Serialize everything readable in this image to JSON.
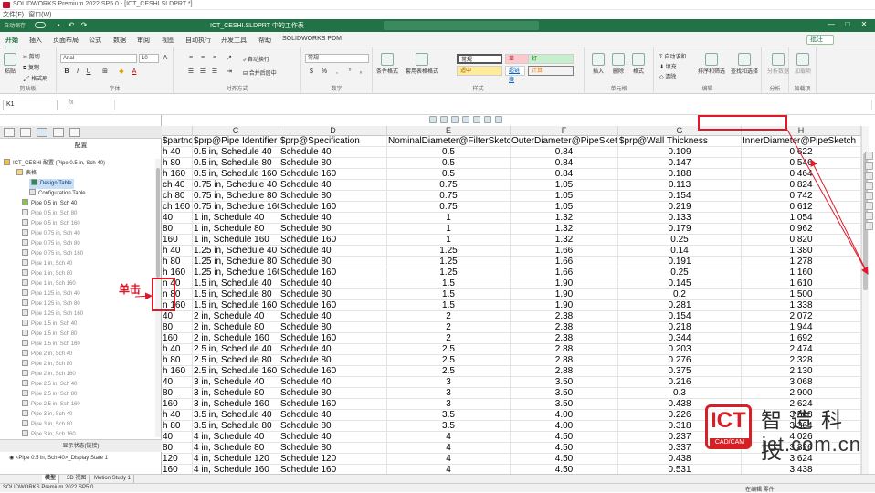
{
  "window": {
    "title": "SOLIDWORKS Premium 2022 SP5.0 - [ICT_CESHI.SLDPRT *]"
  },
  "menubar": {
    "items": [
      "文件(F)",
      "窗口(W)"
    ]
  },
  "qat": {
    "autosave": "自动保存",
    "filename": "ICT_CESHI.SLDPRT 中的工作表",
    "user": "",
    "min": "—",
    "max": "□",
    "close": "✕"
  },
  "tabs": {
    "items": [
      "开始",
      "插入",
      "页面布局",
      "公式",
      "数据",
      "审阅",
      "视图",
      "自动执行",
      "开发工具",
      "帮助",
      "SOLIDWORKS PDM"
    ],
    "active": 0,
    "comment": "批注"
  },
  "ribbon": {
    "clipboard": {
      "label": "剪贴板",
      "paste": "粘贴",
      "cut": "剪切",
      "copy": "复制",
      "format_painter": "格式刷"
    },
    "font": {
      "label": "字体",
      "name": "Arial",
      "size": "10"
    },
    "align": {
      "label": "对齐方式",
      "wrap": "自动换行",
      "merge": "合并后居中"
    },
    "number": {
      "label": "数字",
      "format": "常规"
    },
    "styles": {
      "label": "样式",
      "cond": "条件格式",
      "table": "套用表格格式",
      "normal": "常规",
      "bad": "差",
      "good": "好",
      "neutral": "适中",
      "hyperlink": "超链接",
      "calc": "计算"
    },
    "cells": {
      "label": "单元格",
      "insert": "插入",
      "delete": "删除",
      "format": "格式"
    },
    "editing": {
      "label": "编辑",
      "autosum": "自动求和",
      "fill": "填充",
      "clear": "清除",
      "sort": "排序和筛选",
      "find": "查找和选择"
    },
    "analysis": {
      "label": "分析",
      "analyze": "分析数据"
    },
    "addins": {
      "label": "加载项",
      "addins": "加载项"
    }
  },
  "formula_bar": {
    "name_box": "K1",
    "fx": "fx",
    "value": ""
  },
  "columns": [
    {
      "letter": "",
      "header": "$partno"
    },
    {
      "letter": "C",
      "header": "$prp@Pipe Identifier"
    },
    {
      "letter": "D",
      "header": "$prp@Specification"
    },
    {
      "letter": "E",
      "header": "NominalDiameter@FilterSketch"
    },
    {
      "letter": "F",
      "header": "OuterDiameter@PipeSketch"
    },
    {
      "letter": "G",
      "header": "$prp@Wall Thickness"
    },
    {
      "letter": "H",
      "header": "InnerDiameter@PipeSketch"
    }
  ],
  "rows": [
    [
      "h 40",
      "0.5 in, Schedule 40",
      "Schedule 40",
      "0.5",
      "0.84",
      "0.109",
      "0.622"
    ],
    [
      "h 80",
      "0.5 in, Schedule 80",
      "Schedule 80",
      "0.5",
      "0.84",
      "0.147",
      "0.546"
    ],
    [
      "h 160",
      "0.5 in, Schedule 160",
      "Schedule 160",
      "0.5",
      "0.84",
      "0.188",
      "0.464"
    ],
    [
      "ch 40",
      "0.75 in, Schedule 40",
      "Schedule 40",
      "0.75",
      "1.05",
      "0.113",
      "0.824"
    ],
    [
      "ch 80",
      "0.75 in, Schedule 80",
      "Schedule 80",
      "0.75",
      "1.05",
      "0.154",
      "0.742"
    ],
    [
      "ch 160",
      "0.75 in, Schedule 160",
      "Schedule 160",
      "0.75",
      "1.05",
      "0.219",
      "0.612"
    ],
    [
      "40",
      "1 in, Schedule 40",
      "Schedule 40",
      "1",
      "1.32",
      "0.133",
      "1.054"
    ],
    [
      "80",
      "1 in, Schedule 80",
      "Schedule 80",
      "1",
      "1.32",
      "0.179",
      "0.962"
    ],
    [
      "160",
      "1 in, Schedule 160",
      "Schedule 160",
      "1",
      "1.32",
      "0.25",
      "0.820"
    ],
    [
      "h 40",
      "1.25 in, Schedule 40",
      "Schedule 40",
      "1.25",
      "1.66",
      "0.14",
      "1.380"
    ],
    [
      "h 80",
      "1.25 in, Schedule 80",
      "Schedule 80",
      "1.25",
      "1.66",
      "0.191",
      "1.278"
    ],
    [
      "h 160",
      "1.25 in, Schedule 160",
      "Schedule 160",
      "1.25",
      "1.66",
      "0.25",
      "1.160"
    ],
    [
      "n 40",
      "1.5 in, Schedule 40",
      "Schedule 40",
      "1.5",
      "1.90",
      "0.145",
      "1.610"
    ],
    [
      "n 80",
      "1.5 in, Schedule 80",
      "Schedule 80",
      "1.5",
      "1.90",
      "0.2",
      "1.500"
    ],
    [
      "n 160",
      "1.5 in, Schedule 160",
      "Schedule 160",
      "1.5",
      "1.90",
      "0.281",
      "1.338"
    ],
    [
      "40",
      "2 in, Schedule 40",
      "Schedule 40",
      "2",
      "2.38",
      "0.154",
      "2.072"
    ],
    [
      "80",
      "2 in, Schedule 80",
      "Schedule 80",
      "2",
      "2.38",
      "0.218",
      "1.944"
    ],
    [
      "160",
      "2 in, Schedule 160",
      "Schedule 160",
      "2",
      "2.38",
      "0.344",
      "1.692"
    ],
    [
      "h 40",
      "2.5 in, Schedule 40",
      "Schedule 40",
      "2.5",
      "2.88",
      "0.203",
      "2.474"
    ],
    [
      "h 80",
      "2.5 in, Schedule 80",
      "Schedule 80",
      "2.5",
      "2.88",
      "0.276",
      "2.328"
    ],
    [
      "h 160",
      "2.5 in, Schedule 160",
      "Schedule 160",
      "2.5",
      "2.88",
      "0.375",
      "2.130"
    ],
    [
      "40",
      "3 in, Schedule 40",
      "Schedule 40",
      "3",
      "3.50",
      "0.216",
      "3.068"
    ],
    [
      "80",
      "3 in, Schedule 80",
      "Schedule 80",
      "3",
      "3.50",
      "0.3",
      "2.900"
    ],
    [
      "160",
      "3 in, Schedule 160",
      "Schedule 160",
      "3",
      "3.50",
      "0.438",
      "2.624"
    ],
    [
      "h 40",
      "3.5 in, Schedule 40",
      "Schedule 40",
      "3.5",
      "4.00",
      "0.226",
      "3.548"
    ],
    [
      "h 80",
      "3.5 in, Schedule 80",
      "Schedule 80",
      "3.5",
      "4.00",
      "0.318",
      "3.364"
    ],
    [
      "40",
      "4 in, Schedule 40",
      "Schedule 40",
      "4",
      "4.50",
      "0.237",
      "4.026"
    ],
    [
      "80",
      "4 in, Schedule 80",
      "Schedule 80",
      "4",
      "4.50",
      "0.337",
      "3.826"
    ],
    [
      "120",
      "4 in, Schedule 120",
      "Schedule 120",
      "4",
      "4.50",
      "0.438",
      "3.624"
    ],
    [
      "160",
      "4 in, Schedule 160",
      "Schedule 160",
      "4",
      "4.50",
      "0.531",
      "3.438"
    ]
  ],
  "panel": {
    "title": "配置",
    "root": "ICT_CESHI 配置  (Pipe 0.5 in, Sch 40)",
    "tables": "表格",
    "design_table": "Design Table",
    "config_table": "Configuration Table",
    "configs": [
      "Pipe 0.5 in, Sch 40",
      "Pipe 0.5 in, Sch 80",
      "Pipe 0.5 in, Sch 160",
      "Pipe 0.75 in, Sch 40",
      "Pipe 0.75 in, Sch 80",
      "Pipe 0.75 in, Sch 160",
      "Pipe 1 in, Sch 40",
      "Pipe 1 in, Sch 80",
      "Pipe 1 in, Sch 160",
      "Pipe 1.25 in, Sch 40",
      "Pipe 1.25 in, Sch 80",
      "Pipe 1.25 in, Sch 160",
      "Pipe 1.5 in, Sch 40",
      "Pipe 1.5 in, Sch 80",
      "Pipe 1.5 in, Sch 160",
      "Pipe 2 in, Sch 40",
      "Pipe 2 in, Sch 80",
      "Pipe 2 in, Sch 160",
      "Pipe 2.5 in, Sch 40",
      "Pipe 2.5 in, Sch 80",
      "Pipe 2.5 in, Sch 160",
      "Pipe 3 in, Sch 40",
      "Pipe 3 in, Sch 80",
      "Pipe 3 in, Sch 160"
    ],
    "display_state_header": "显示状态(链接)",
    "display_state": "<Pipe 0.5 in, Sch 40>_Display State 1"
  },
  "sheet_tabs": [
    "模型",
    "3D 视图",
    "Motion Study 1"
  ],
  "status": {
    "left": "SOLIDWORKS Premium 2022 SP5.0",
    "right1": "在编辑 零件",
    "right2": ""
  },
  "annotation": {
    "label": "单击"
  },
  "watermark": {
    "logo": "ICT",
    "sub": "CAD/CAM",
    "cn": "智造科技",
    "url": "ict.com.cn"
  },
  "colors": {
    "excel_green": "#217346",
    "annotation_red": "#e0182a",
    "selection_blue": "#c9dff5"
  }
}
